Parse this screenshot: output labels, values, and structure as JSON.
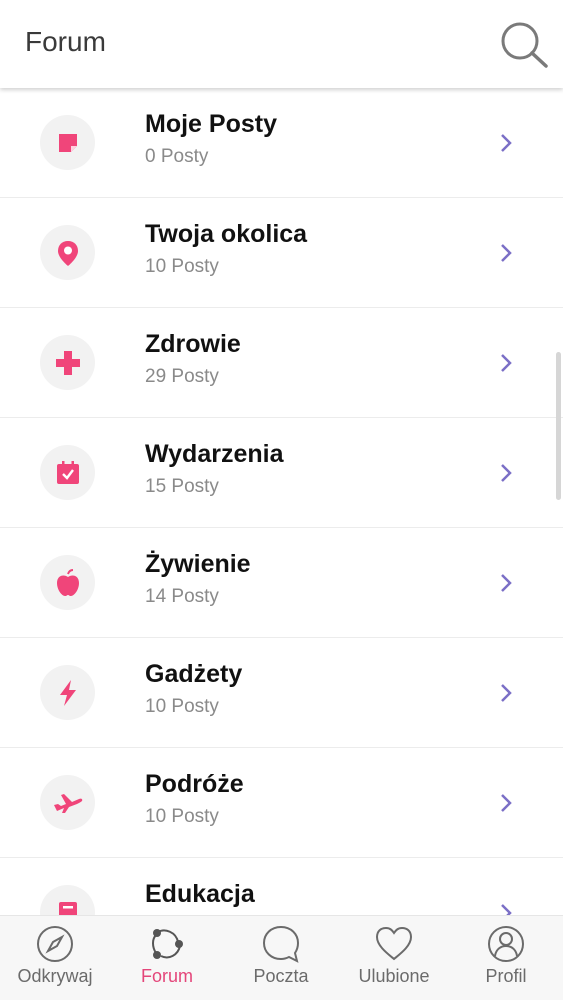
{
  "header": {
    "title": "Forum",
    "search_icon": "search-icon"
  },
  "theme": {
    "accent": "#f0457a",
    "chevron": "#7b6fc6",
    "icon_bg": "#f2f2f2",
    "nav_active": "#e4467a"
  },
  "categories": [
    {
      "title": "Moje Posty",
      "subtitle": "0 Posty",
      "icon": "note-icon"
    },
    {
      "title": "Twoja okolica",
      "subtitle": "10 Posty",
      "icon": "location-pin-icon"
    },
    {
      "title": "Zdrowie",
      "subtitle": "29 Posty",
      "icon": "medical-cross-icon"
    },
    {
      "title": "Wydarzenia",
      "subtitle": "15 Posty",
      "icon": "calendar-icon"
    },
    {
      "title": "Żywienie",
      "subtitle": "14 Posty",
      "icon": "apple-icon"
    },
    {
      "title": "Gadżety",
      "subtitle": "10 Posty",
      "icon": "lightning-icon"
    },
    {
      "title": "Podróże",
      "subtitle": "10 Posty",
      "icon": "airplane-icon"
    },
    {
      "title": "Edukacja",
      "subtitle": "",
      "icon": "book-icon"
    }
  ],
  "bottom_nav": [
    {
      "label": "Odkrywaj",
      "icon": "compass-icon",
      "active": false
    },
    {
      "label": "Forum",
      "icon": "forum-network-icon",
      "active": true
    },
    {
      "label": "Poczta",
      "icon": "chat-bubble-icon",
      "active": false
    },
    {
      "label": "Ulubione",
      "icon": "heart-icon",
      "active": false
    },
    {
      "label": "Profil",
      "icon": "profile-icon",
      "active": false
    }
  ]
}
